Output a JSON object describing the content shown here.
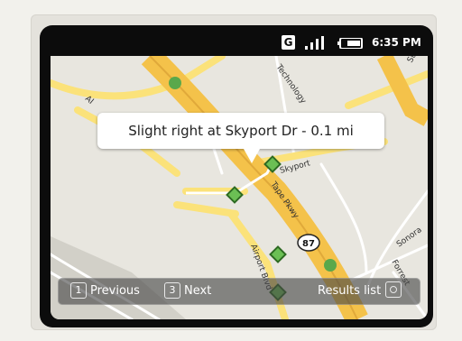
{
  "status_bar": {
    "network_icon": "g-network-icon",
    "network_letter": "G",
    "signal_icon": "signal-bars-icon",
    "battery_icon": "battery-icon",
    "time": "6:35 PM"
  },
  "map": {
    "labels": {
      "technology": "Technology",
      "skyport": "Skyport",
      "tape_pkwy": "Tape Pkwy",
      "airport_blvd": "Airport Blvd",
      "sonora": "Sonora",
      "forrest": "Forrest",
      "highway": "87",
      "al": "Al",
      "st": "St"
    },
    "colors": {
      "land": "#e8e6df",
      "minor_road": "#ffffff",
      "major_road": "#fbe27a",
      "freeway": "#f4c24a",
      "marker": "#6bbf54",
      "poi": "#5aa84b"
    }
  },
  "tooltip": {
    "instruction": "Slight right at Skyport Dr - 0.1 mi"
  },
  "navigation": {
    "previous_key": "1",
    "previous_label": "Previous",
    "next_key": "3",
    "next_label": "Next",
    "results_label": "Results list"
  }
}
